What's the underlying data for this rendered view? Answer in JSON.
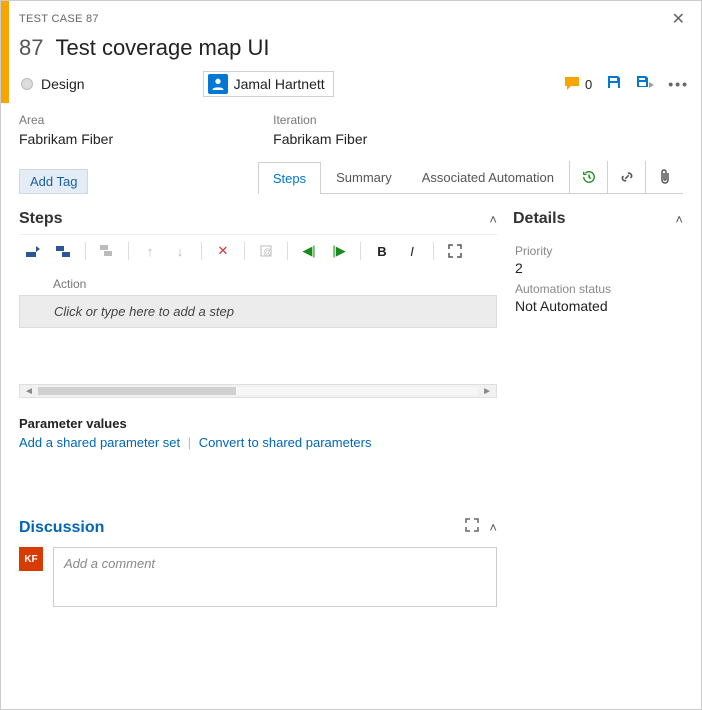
{
  "header": {
    "type_label": "TEST CASE 87",
    "id": "87",
    "title": "Test coverage map UI",
    "state": "Design",
    "assignee": "Jamal Hartnett",
    "comment_count": "0"
  },
  "fields": {
    "area_label": "Area",
    "area_value": "Fabrikam Fiber",
    "iteration_label": "Iteration",
    "iteration_value": "Fabrikam Fiber"
  },
  "tags": {
    "add_label": "Add Tag"
  },
  "tabs": {
    "steps": "Steps",
    "summary": "Summary",
    "automation": "Associated Automation"
  },
  "steps": {
    "section_title": "Steps",
    "grid_header": "Action",
    "placeholder": "Click or type here to add a step"
  },
  "parameters": {
    "title": "Parameter values",
    "add_shared": "Add a shared parameter set",
    "convert": "Convert to shared parameters"
  },
  "details": {
    "section_title": "Details",
    "priority_label": "Priority",
    "priority_value": "2",
    "automation_label": "Automation status",
    "automation_value": "Not Automated"
  },
  "discussion": {
    "title": "Discussion",
    "avatar_initials": "KF",
    "placeholder": "Add a comment"
  }
}
